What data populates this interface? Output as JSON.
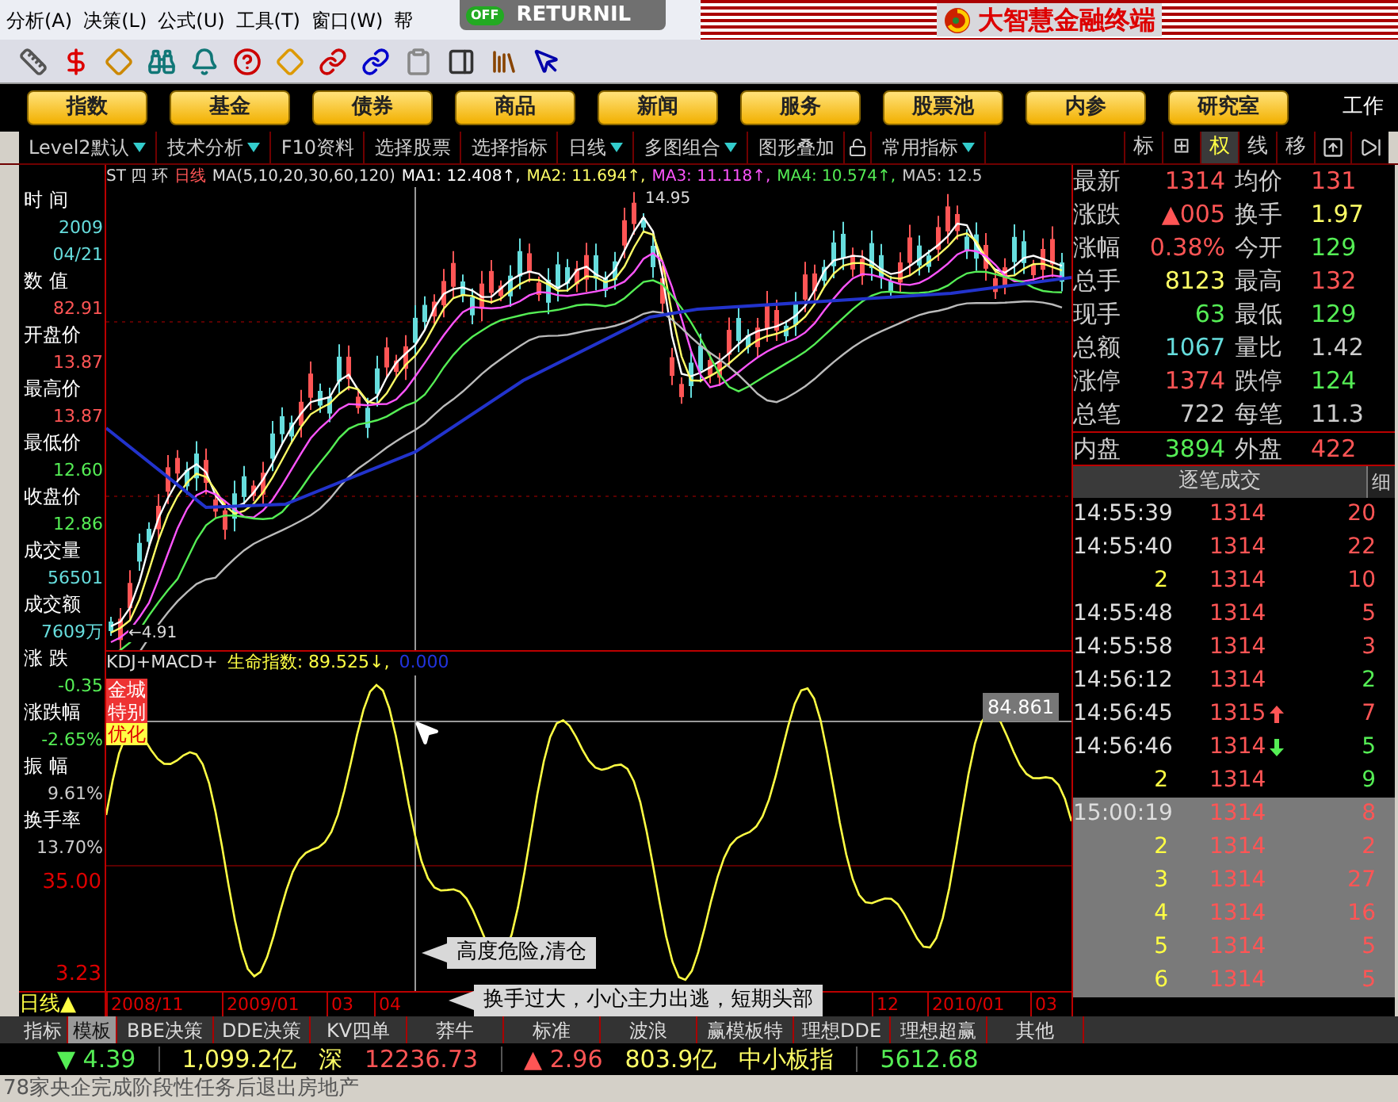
{
  "menu_bar": {
    "items": [
      "分析(A)",
      "决策(L)",
      "公式(U)",
      "工具(T)",
      "窗口(W)",
      "帮"
    ]
  },
  "overlay_badge": {
    "status": "OFF",
    "name": "RETURNIL"
  },
  "app_title": "大智慧金融终端",
  "nav_buttons": [
    "指数",
    "基金",
    "债券",
    "商品",
    "新闻",
    "服务",
    "股票池",
    "内参",
    "研究室"
  ],
  "nav_extra": "工作",
  "tool_tabs": [
    {
      "label": "Level2默认",
      "dropdown": true
    },
    {
      "label": "技术分析",
      "dropdown": true
    },
    {
      "label": "F10资料",
      "dropdown": false
    },
    {
      "label": "选择股票",
      "dropdown": false
    },
    {
      "label": "选择指标",
      "dropdown": false
    },
    {
      "label": "日线",
      "dropdown": true
    },
    {
      "label": "多图组合",
      "dropdown": true
    },
    {
      "label": "图形叠加",
      "dropdown": false
    },
    {
      "label": "常用指标",
      "dropdown": true
    }
  ],
  "view_tabs": [
    {
      "label": "标",
      "selected": false
    },
    {
      "label": "⊞",
      "selected": false
    },
    {
      "label": "权",
      "selected": true
    },
    {
      "label": "线",
      "selected": false
    },
    {
      "label": "移",
      "selected": false
    }
  ],
  "info_panel": {
    "items": [
      {
        "label": "时 间",
        "values": [
          {
            "text": "2009",
            "color": "#66dddd"
          },
          {
            "text": "04/21",
            "color": "#66dddd"
          }
        ]
      },
      {
        "label": "数 值",
        "values": [
          {
            "text": "82.91",
            "color": "#ff5555"
          }
        ]
      },
      {
        "label": "开盘价",
        "values": [
          {
            "text": "13.87",
            "color": "#ff5555"
          }
        ]
      },
      {
        "label": "最高价",
        "values": [
          {
            "text": "13.87",
            "color": "#ff5555"
          }
        ]
      },
      {
        "label": "最低价",
        "values": [
          {
            "text": "12.60",
            "color": "#55ee55"
          }
        ]
      },
      {
        "label": "收盘价",
        "values": [
          {
            "text": "12.86",
            "color": "#55ee55"
          }
        ]
      },
      {
        "label": "成交量",
        "values": [
          {
            "text": "56501",
            "color": "#66dddd"
          }
        ]
      },
      {
        "label": "成交额",
        "values": [
          {
            "text": "7609万",
            "color": "#66dddd"
          }
        ]
      },
      {
        "label": "涨 跌",
        "values": [
          {
            "text": "-0.35",
            "color": "#55ee55"
          }
        ]
      },
      {
        "label": "涨跌幅",
        "values": [
          {
            "text": "-2.65%",
            "color": "#55ee55"
          }
        ]
      },
      {
        "label": "振 幅",
        "values": [
          {
            "text": "9.61%",
            "color": "#cccccc"
          }
        ]
      },
      {
        "label": "换手率",
        "values": [
          {
            "text": "13.70%",
            "color": "#cccccc"
          }
        ]
      }
    ],
    "axis_labels": [
      "35.00",
      "3.23"
    ]
  },
  "price_chart": {
    "stock": "ST 四 环",
    "period": "日线",
    "indicator": "MA(5,10,20,30,60,120)",
    "ma_values": [
      {
        "text": "MA1: 12.408↑,",
        "color": "#ffffff"
      },
      {
        "text": "MA2: 11.694↑,",
        "color": "#ffff66"
      },
      {
        "text": "MA3: 11.118↑,",
        "color": "#ff55ff"
      },
      {
        "text": "MA4: 10.574↑,",
        "color": "#55ee55"
      },
      {
        "text": "MA5: 12.5",
        "color": "#cccccc"
      }
    ],
    "high_mark": "14.95",
    "low_mark": "←4.91"
  },
  "indicator_chart": {
    "title": "KDJ+MACD+",
    "index_label": "生命指数: 89.525↓,",
    "index_extra": "0.000",
    "marker": "84.861",
    "badges": [
      {
        "text": "金城",
        "kind": "red"
      },
      {
        "text": "特别",
        "kind": "red"
      },
      {
        "text": "优化",
        "kind": "yellow"
      }
    ]
  },
  "tooltips": [
    "高度危险,清仓",
    "换手过大，小心主力出逃，短期头部"
  ],
  "date_axis": {
    "period": "日线▲",
    "dates": [
      "2008/11",
      "2009/01",
      "03",
      "04",
      "12",
      "2010/01",
      "03"
    ]
  },
  "quote": {
    "rows": [
      {
        "cells": [
          {
            "text": "最新"
          },
          {
            "text": "1314",
            "color": "#ff5555"
          },
          {
            "text": "均价"
          },
          {
            "text": "131",
            "color": "#ff5555"
          }
        ]
      },
      {
        "cells": [
          {
            "text": "涨跌"
          },
          {
            "text": "▲005",
            "color": "#ff5555"
          },
          {
            "text": "换手"
          },
          {
            "text": "1.97",
            "color": "#ffff66"
          }
        ]
      },
      {
        "cells": [
          {
            "text": "涨幅"
          },
          {
            "text": "0.38%",
            "color": "#ff5555"
          },
          {
            "text": "今开"
          },
          {
            "text": "129",
            "color": "#55ee55"
          }
        ]
      },
      {
        "cells": [
          {
            "text": "总手"
          },
          {
            "text": "8123",
            "color": "#ffff66"
          },
          {
            "text": "最高"
          },
          {
            "text": "132",
            "color": "#ff5555"
          }
        ]
      },
      {
        "cells": [
          {
            "text": "现手"
          },
          {
            "text": "63",
            "color": "#55ee55"
          },
          {
            "text": "最低"
          },
          {
            "text": "129",
            "color": "#55ee55"
          }
        ]
      },
      {
        "cells": [
          {
            "text": "总额"
          },
          {
            "text": "1067",
            "color": "#66dddd"
          },
          {
            "text": "量比"
          },
          {
            "text": "1.42",
            "color": "#cccccc"
          }
        ]
      },
      {
        "cells": [
          {
            "text": "涨停"
          },
          {
            "text": "1374",
            "color": "#ff5555"
          },
          {
            "text": "跌停"
          },
          {
            "text": "124",
            "color": "#55ee55"
          }
        ]
      },
      {
        "cells": [
          {
            "text": "总笔"
          },
          {
            "text": "722",
            "color": "#cccccc"
          },
          {
            "text": "每笔"
          },
          {
            "text": "11.3",
            "color": "#cccccc"
          }
        ]
      }
    ],
    "inner": [
      {
        "text": "内盘"
      },
      {
        "text": "3894",
        "color": "#55ee55"
      },
      {
        "text": "外盘"
      },
      {
        "text": "422",
        "color": "#ff5555"
      }
    ]
  },
  "trades": {
    "title": "逐笔成交",
    "side_tab": "细",
    "rows": [
      {
        "time": "14:55:39",
        "kind": "time",
        "price": "1314",
        "up": false,
        "down": false,
        "volume": "20",
        "color": "#ff5555",
        "selected": false
      },
      {
        "time": "14:55:40",
        "kind": "time",
        "price": "1314",
        "up": false,
        "down": false,
        "volume": "22",
        "color": "#ff5555",
        "selected": false
      },
      {
        "time": "2",
        "kind": "sequence",
        "price": "1314",
        "up": false,
        "down": false,
        "volume": "10",
        "color": "#ff5555",
        "selected": false
      },
      {
        "time": "14:55:48",
        "kind": "time",
        "price": "1314",
        "up": false,
        "down": false,
        "volume": "5",
        "color": "#ff5555",
        "selected": false
      },
      {
        "time": "14:55:58",
        "kind": "time",
        "price": "1314",
        "up": false,
        "down": false,
        "volume": "3",
        "color": "#ff5555",
        "selected": false
      },
      {
        "time": "14:56:12",
        "kind": "time",
        "price": "1314",
        "up": false,
        "down": false,
        "volume": "2",
        "color": "#55ee55",
        "selected": false
      },
      {
        "time": "14:56:45",
        "kind": "time",
        "price": "1315",
        "up": true,
        "down": false,
        "volume": "7",
        "color": "#ff5555",
        "selected": false
      },
      {
        "time": "14:56:46",
        "kind": "time",
        "price": "1314",
        "up": false,
        "down": true,
        "volume": "5",
        "color": "#55ee55",
        "selected": false
      },
      {
        "time": "2",
        "kind": "sequence",
        "price": "1314",
        "up": false,
        "down": false,
        "volume": "9",
        "color": "#55ee55",
        "selected": false
      },
      {
        "time": "15:00:19",
        "kind": "time",
        "price": "1314",
        "up": false,
        "down": false,
        "volume": "8",
        "color": "#ff5555",
        "selected": true
      },
      {
        "time": "2",
        "kind": "sequence",
        "price": "1314",
        "up": false,
        "down": false,
        "volume": "2",
        "color": "#ff5555",
        "selected": true
      },
      {
        "time": "3",
        "kind": "sequence",
        "price": "1314",
        "up": false,
        "down": false,
        "volume": "27",
        "color": "#ff5555",
        "selected": true
      },
      {
        "time": "4",
        "kind": "sequence",
        "price": "1314",
        "up": false,
        "down": false,
        "volume": "16",
        "color": "#ff5555",
        "selected": true
      },
      {
        "time": "5",
        "kind": "sequence",
        "price": "1314",
        "up": false,
        "down": false,
        "volume": "5",
        "color": "#ff5555",
        "selected": true
      },
      {
        "time": "6",
        "kind": "sequence",
        "price": "1314",
        "up": false,
        "down": false,
        "volume": "5",
        "color": "#ff5555",
        "selected": true
      }
    ]
  },
  "bottom_tabs": [
    {
      "label": "指标",
      "selected": false
    },
    {
      "label": "模板",
      "selected": true
    },
    {
      "label": "BBE决策",
      "selected": false
    },
    {
      "label": "DDE决策",
      "selected": false
    },
    {
      "label": "KV四单",
      "selected": false
    },
    {
      "label": "莽牛",
      "selected": false
    },
    {
      "label": "标准",
      "selected": false
    },
    {
      "label": "波浪",
      "selected": false
    },
    {
      "label": "赢模板特",
      "selected": false
    },
    {
      "label": "理想DDE",
      "selected": false
    },
    {
      "label": "理想超赢",
      "selected": false
    },
    {
      "label": "其他",
      "selected": false
    }
  ],
  "status_bar": [
    {
      "text": "▼ 4.39",
      "color": "#55ee55"
    },
    {
      "text": "1,099.2亿",
      "color": "#ffff66"
    },
    {
      "text": "深",
      "color": "#ffff66"
    },
    {
      "text": "12236.73",
      "color": "#ff5555"
    },
    {
      "text": "▲ 2.96",
      "color": "#ff5555"
    },
    {
      "text": "803.9亿",
      "color": "#ffff66"
    },
    {
      "text": "中小板指",
      "color": "#ffff66"
    },
    {
      "text": "5612.68",
      "color": "#55ee55"
    }
  ],
  "ticker": "78家央企完成阶段性任务后退出房地产"
}
